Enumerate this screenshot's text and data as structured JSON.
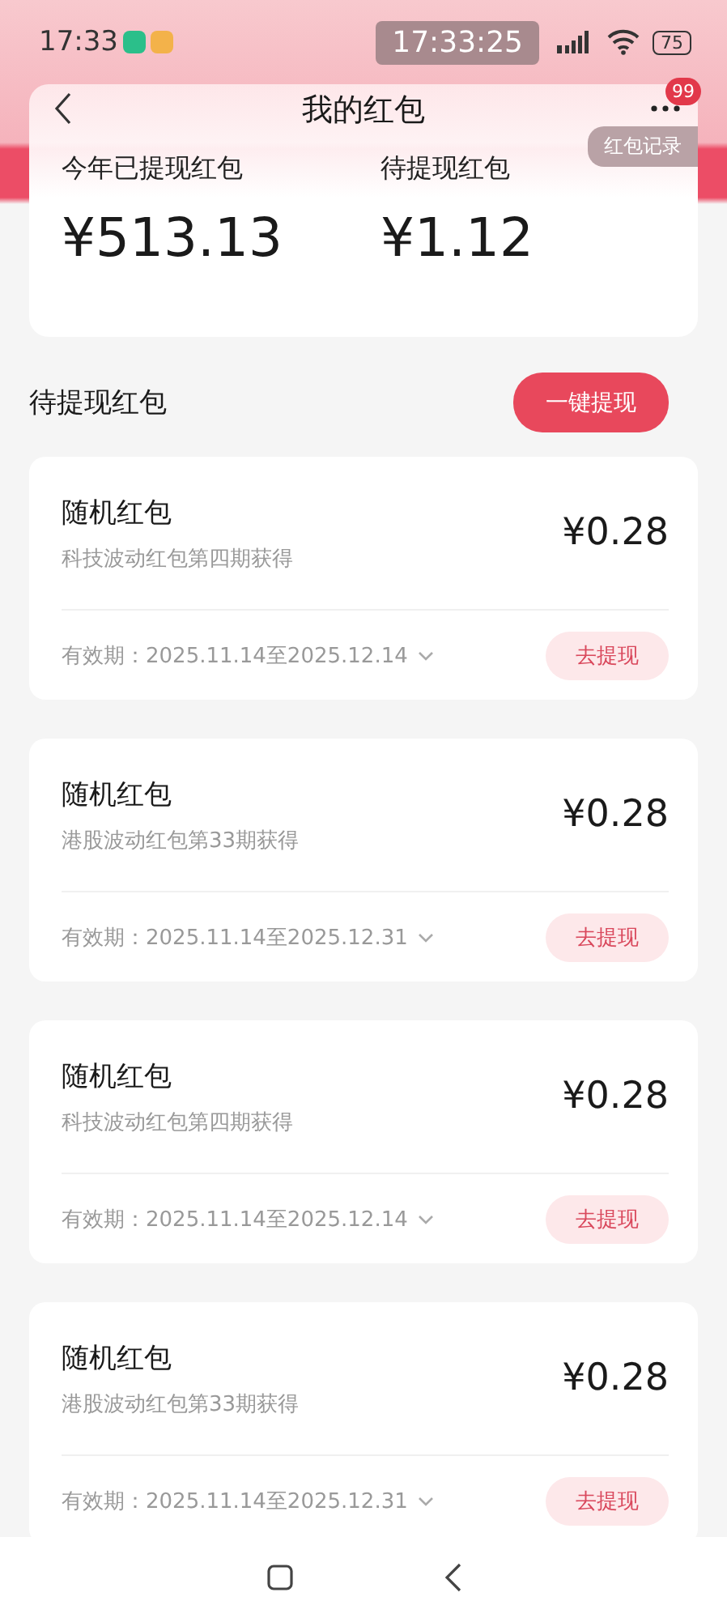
{
  "status_bar": {
    "time": "17:33",
    "clock": "17:33:25",
    "battery": "75"
  },
  "header": {
    "title": "我的红包",
    "badge": "99",
    "tooltip": "红包记录"
  },
  "summary": [
    {
      "label": "今年已提现红包",
      "amount": "¥513.13"
    },
    {
      "label": "待提现红包",
      "amount": "¥1.12"
    }
  ],
  "section": {
    "title": "待提现红包",
    "button": "一键提现"
  },
  "packets": [
    {
      "name": "随机红包",
      "source": "科技波动红包第四期获得",
      "amount": "¥0.28",
      "validity": "有效期：2025.11.14至2025.12.14",
      "action": "去提现"
    },
    {
      "name": "随机红包",
      "source": "港股波动红包第33期获得",
      "amount": "¥0.28",
      "validity": "有效期：2025.11.14至2025.12.31",
      "action": "去提现"
    },
    {
      "name": "随机红包",
      "source": "科技波动红包第四期获得",
      "amount": "¥0.28",
      "validity": "有效期：2025.11.14至2025.12.14",
      "action": "去提现"
    },
    {
      "name": "随机红包",
      "source": "港股波动红包第33期获得",
      "amount": "¥0.28",
      "validity": "有效期：2025.11.14至2025.12.31",
      "action": "去提现"
    }
  ]
}
